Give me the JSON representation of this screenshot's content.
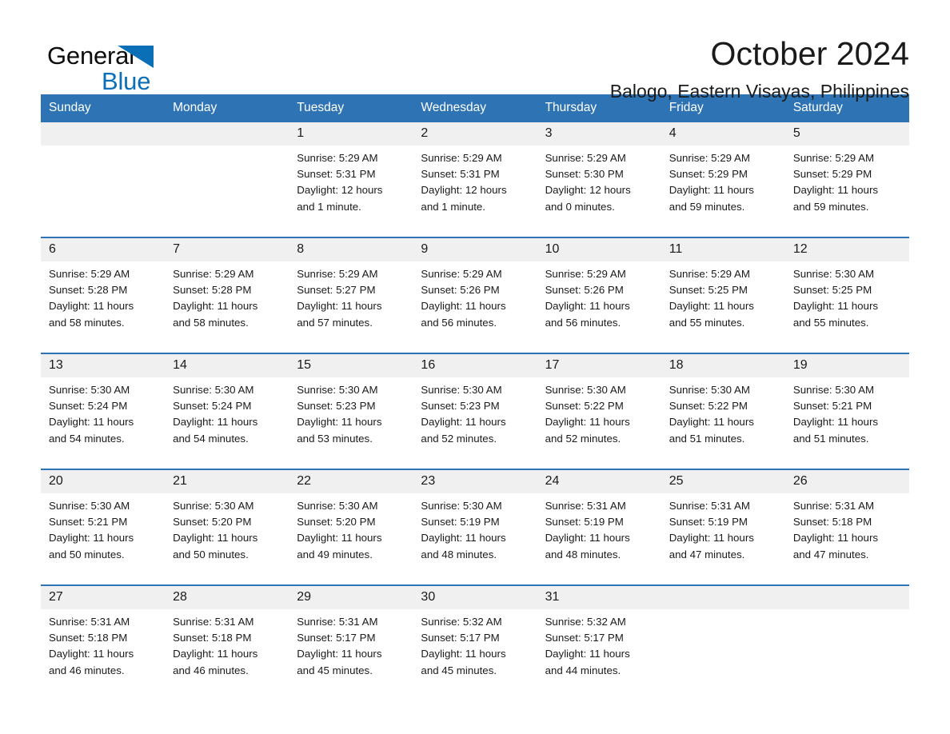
{
  "brand": {
    "word_one": "General",
    "word_two": "Blue",
    "triangle_color": "#0b6fb8",
    "text_color": "#0d0d0d"
  },
  "header": {
    "month_title": "October 2024",
    "location": "Balogo, Eastern Visayas, Philippines",
    "header_bg": "#2e74b5",
    "header_text_color": "#ffffff",
    "date_band_bg": "#f0f0f0"
  },
  "weekday_headers": [
    "Sunday",
    "Monday",
    "Tuesday",
    "Wednesday",
    "Thursday",
    "Friday",
    "Saturday"
  ],
  "weeks": [
    {
      "days": [
        {
          "date": "",
          "sunrise": "",
          "sunset": "",
          "daylight_1": "",
          "daylight_2": "",
          "empty": true
        },
        {
          "date": "",
          "sunrise": "",
          "sunset": "",
          "daylight_1": "",
          "daylight_2": "",
          "empty": true
        },
        {
          "date": "1",
          "sunrise": "Sunrise: 5:29 AM",
          "sunset": "Sunset: 5:31 PM",
          "daylight_1": "Daylight: 12 hours",
          "daylight_2": "and 1 minute.",
          "empty": false
        },
        {
          "date": "2",
          "sunrise": "Sunrise: 5:29 AM",
          "sunset": "Sunset: 5:31 PM",
          "daylight_1": "Daylight: 12 hours",
          "daylight_2": "and 1 minute.",
          "empty": false
        },
        {
          "date": "3",
          "sunrise": "Sunrise: 5:29 AM",
          "sunset": "Sunset: 5:30 PM",
          "daylight_1": "Daylight: 12 hours",
          "daylight_2": "and 0 minutes.",
          "empty": false
        },
        {
          "date": "4",
          "sunrise": "Sunrise: 5:29 AM",
          "sunset": "Sunset: 5:29 PM",
          "daylight_1": "Daylight: 11 hours",
          "daylight_2": "and 59 minutes.",
          "empty": false
        },
        {
          "date": "5",
          "sunrise": "Sunrise: 5:29 AM",
          "sunset": "Sunset: 5:29 PM",
          "daylight_1": "Daylight: 11 hours",
          "daylight_2": "and 59 minutes.",
          "empty": false
        }
      ]
    },
    {
      "days": [
        {
          "date": "6",
          "sunrise": "Sunrise: 5:29 AM",
          "sunset": "Sunset: 5:28 PM",
          "daylight_1": "Daylight: 11 hours",
          "daylight_2": "and 58 minutes.",
          "empty": false
        },
        {
          "date": "7",
          "sunrise": "Sunrise: 5:29 AM",
          "sunset": "Sunset: 5:28 PM",
          "daylight_1": "Daylight: 11 hours",
          "daylight_2": "and 58 minutes.",
          "empty": false
        },
        {
          "date": "8",
          "sunrise": "Sunrise: 5:29 AM",
          "sunset": "Sunset: 5:27 PM",
          "daylight_1": "Daylight: 11 hours",
          "daylight_2": "and 57 minutes.",
          "empty": false
        },
        {
          "date": "9",
          "sunrise": "Sunrise: 5:29 AM",
          "sunset": "Sunset: 5:26 PM",
          "daylight_1": "Daylight: 11 hours",
          "daylight_2": "and 56 minutes.",
          "empty": false
        },
        {
          "date": "10",
          "sunrise": "Sunrise: 5:29 AM",
          "sunset": "Sunset: 5:26 PM",
          "daylight_1": "Daylight: 11 hours",
          "daylight_2": "and 56 minutes.",
          "empty": false
        },
        {
          "date": "11",
          "sunrise": "Sunrise: 5:29 AM",
          "sunset": "Sunset: 5:25 PM",
          "daylight_1": "Daylight: 11 hours",
          "daylight_2": "and 55 minutes.",
          "empty": false
        },
        {
          "date": "12",
          "sunrise": "Sunrise: 5:30 AM",
          "sunset": "Sunset: 5:25 PM",
          "daylight_1": "Daylight: 11 hours",
          "daylight_2": "and 55 minutes.",
          "empty": false
        }
      ]
    },
    {
      "days": [
        {
          "date": "13",
          "sunrise": "Sunrise: 5:30 AM",
          "sunset": "Sunset: 5:24 PM",
          "daylight_1": "Daylight: 11 hours",
          "daylight_2": "and 54 minutes.",
          "empty": false
        },
        {
          "date": "14",
          "sunrise": "Sunrise: 5:30 AM",
          "sunset": "Sunset: 5:24 PM",
          "daylight_1": "Daylight: 11 hours",
          "daylight_2": "and 54 minutes.",
          "empty": false
        },
        {
          "date": "15",
          "sunrise": "Sunrise: 5:30 AM",
          "sunset": "Sunset: 5:23 PM",
          "daylight_1": "Daylight: 11 hours",
          "daylight_2": "and 53 minutes.",
          "empty": false
        },
        {
          "date": "16",
          "sunrise": "Sunrise: 5:30 AM",
          "sunset": "Sunset: 5:23 PM",
          "daylight_1": "Daylight: 11 hours",
          "daylight_2": "and 52 minutes.",
          "empty": false
        },
        {
          "date": "17",
          "sunrise": "Sunrise: 5:30 AM",
          "sunset": "Sunset: 5:22 PM",
          "daylight_1": "Daylight: 11 hours",
          "daylight_2": "and 52 minutes.",
          "empty": false
        },
        {
          "date": "18",
          "sunrise": "Sunrise: 5:30 AM",
          "sunset": "Sunset: 5:22 PM",
          "daylight_1": "Daylight: 11 hours",
          "daylight_2": "and 51 minutes.",
          "empty": false
        },
        {
          "date": "19",
          "sunrise": "Sunrise: 5:30 AM",
          "sunset": "Sunset: 5:21 PM",
          "daylight_1": "Daylight: 11 hours",
          "daylight_2": "and 51 minutes.",
          "empty": false
        }
      ]
    },
    {
      "days": [
        {
          "date": "20",
          "sunrise": "Sunrise: 5:30 AM",
          "sunset": "Sunset: 5:21 PM",
          "daylight_1": "Daylight: 11 hours",
          "daylight_2": "and 50 minutes.",
          "empty": false
        },
        {
          "date": "21",
          "sunrise": "Sunrise: 5:30 AM",
          "sunset": "Sunset: 5:20 PM",
          "daylight_1": "Daylight: 11 hours",
          "daylight_2": "and 50 minutes.",
          "empty": false
        },
        {
          "date": "22",
          "sunrise": "Sunrise: 5:30 AM",
          "sunset": "Sunset: 5:20 PM",
          "daylight_1": "Daylight: 11 hours",
          "daylight_2": "and 49 minutes.",
          "empty": false
        },
        {
          "date": "23",
          "sunrise": "Sunrise: 5:30 AM",
          "sunset": "Sunset: 5:19 PM",
          "daylight_1": "Daylight: 11 hours",
          "daylight_2": "and 48 minutes.",
          "empty": false
        },
        {
          "date": "24",
          "sunrise": "Sunrise: 5:31 AM",
          "sunset": "Sunset: 5:19 PM",
          "daylight_1": "Daylight: 11 hours",
          "daylight_2": "and 48 minutes.",
          "empty": false
        },
        {
          "date": "25",
          "sunrise": "Sunrise: 5:31 AM",
          "sunset": "Sunset: 5:19 PM",
          "daylight_1": "Daylight: 11 hours",
          "daylight_2": "and 47 minutes.",
          "empty": false
        },
        {
          "date": "26",
          "sunrise": "Sunrise: 5:31 AM",
          "sunset": "Sunset: 5:18 PM",
          "daylight_1": "Daylight: 11 hours",
          "daylight_2": "and 47 minutes.",
          "empty": false
        }
      ]
    },
    {
      "days": [
        {
          "date": "27",
          "sunrise": "Sunrise: 5:31 AM",
          "sunset": "Sunset: 5:18 PM",
          "daylight_1": "Daylight: 11 hours",
          "daylight_2": "and 46 minutes.",
          "empty": false
        },
        {
          "date": "28",
          "sunrise": "Sunrise: 5:31 AM",
          "sunset": "Sunset: 5:18 PM",
          "daylight_1": "Daylight: 11 hours",
          "daylight_2": "and 46 minutes.",
          "empty": false
        },
        {
          "date": "29",
          "sunrise": "Sunrise: 5:31 AM",
          "sunset": "Sunset: 5:17 PM",
          "daylight_1": "Daylight: 11 hours",
          "daylight_2": "and 45 minutes.",
          "empty": false
        },
        {
          "date": "30",
          "sunrise": "Sunrise: 5:32 AM",
          "sunset": "Sunset: 5:17 PM",
          "daylight_1": "Daylight: 11 hours",
          "daylight_2": "and 45 minutes.",
          "empty": false
        },
        {
          "date": "31",
          "sunrise": "Sunrise: 5:32 AM",
          "sunset": "Sunset: 5:17 PM",
          "daylight_1": "Daylight: 11 hours",
          "daylight_2": "and 44 minutes.",
          "empty": false
        },
        {
          "date": "",
          "sunrise": "",
          "sunset": "",
          "daylight_1": "",
          "daylight_2": "",
          "empty": true
        },
        {
          "date": "",
          "sunrise": "",
          "sunset": "",
          "daylight_1": "",
          "daylight_2": "",
          "empty": true
        }
      ]
    }
  ]
}
